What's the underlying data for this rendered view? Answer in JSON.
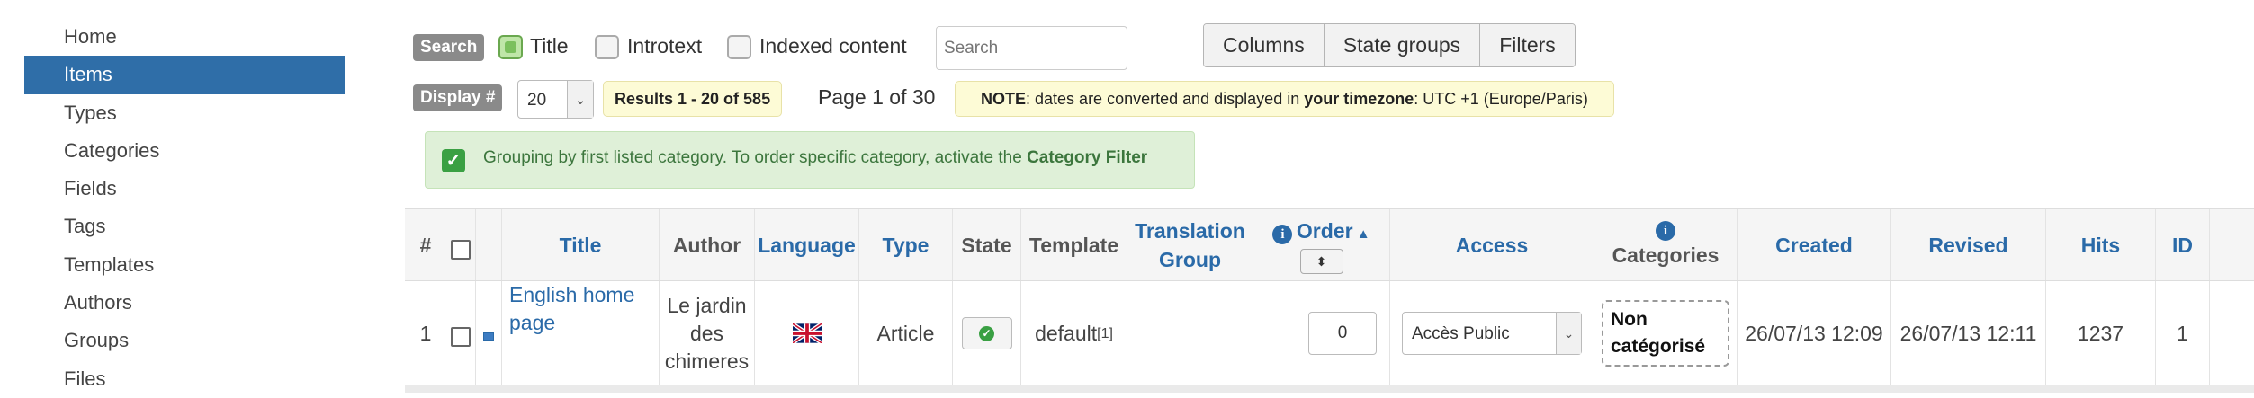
{
  "sidebar": {
    "items": [
      {
        "label": "Home",
        "active": false
      },
      {
        "label": "Items",
        "active": true
      },
      {
        "label": "Types",
        "active": false
      },
      {
        "label": "Categories",
        "active": false
      },
      {
        "label": "Fields",
        "active": false
      },
      {
        "label": "Tags",
        "active": false
      },
      {
        "label": "Templates",
        "active": false
      },
      {
        "label": "Authors",
        "active": false
      },
      {
        "label": "Groups",
        "active": false
      },
      {
        "label": "Files",
        "active": false
      }
    ]
  },
  "toolbar": {
    "search_badge": "Search",
    "filters": [
      {
        "label": "Title",
        "checked": true
      },
      {
        "label": "Introtext",
        "checked": false
      },
      {
        "label": "Indexed content",
        "checked": false
      }
    ],
    "search_placeholder": "Search",
    "buttons": [
      "Columns",
      "State groups",
      "Filters"
    ],
    "display_badge": "Display #",
    "display_value": "20",
    "results": "Results 1 - 20 of 585",
    "page_info": "Page 1 of 30",
    "note_label": "NOTE",
    "note_text_1": ": dates are converted and displayed in ",
    "note_bold": "your timezone",
    "note_text_2": ": UTC +1 (Europe/Paris)"
  },
  "alert": {
    "text": "Grouping by first listed category. To order specific category, activate the ",
    "bold": "Category Filter"
  },
  "table": {
    "headers": {
      "num": "#",
      "title": "Title",
      "author": "Author",
      "language": "Language",
      "type": "Type",
      "state": "State",
      "template": "Template",
      "translation_group_1": "Translation",
      "translation_group_2": "Group",
      "order": "Order",
      "access": "Access",
      "categories": "Categories",
      "created": "Created",
      "revised": "Revised",
      "hits": "Hits",
      "id": "ID"
    },
    "rows": [
      {
        "num": "1",
        "title_1": "English home",
        "title_2": "page",
        "author_1": "Le jardin",
        "author_2": "des",
        "author_3": "chimeres",
        "type": "Article",
        "template": "default",
        "template_sup": "[1]",
        "order": "0",
        "access": "Accès Public",
        "category_1": "Non",
        "category_2": "catégorisé",
        "created": "26/07/13 12:09",
        "revised": "26/07/13 12:11",
        "hits": "1237",
        "id": "1"
      }
    ]
  }
}
